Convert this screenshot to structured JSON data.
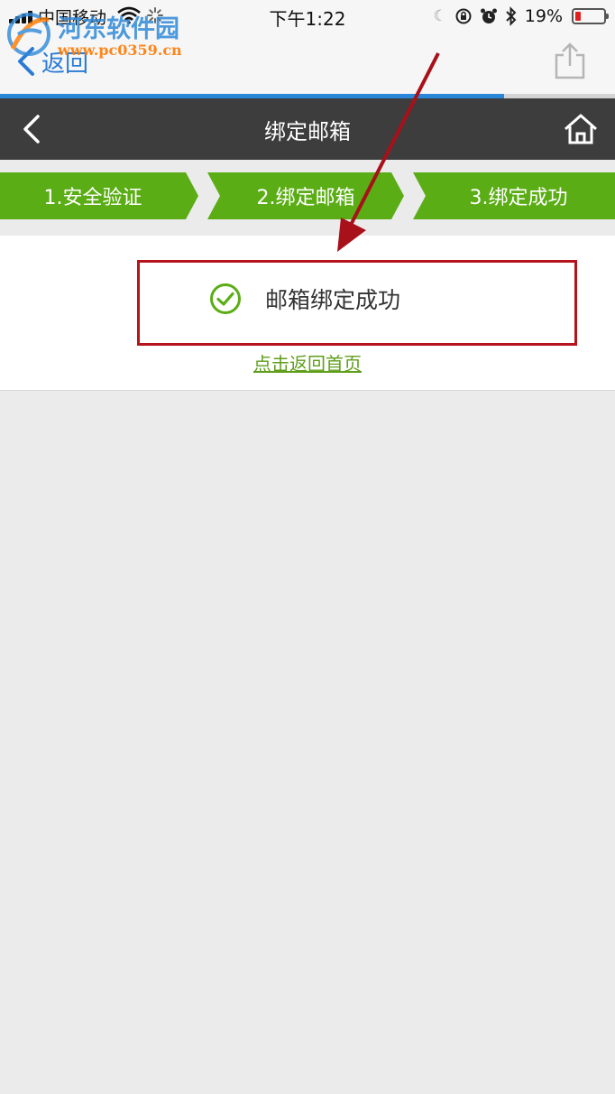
{
  "status_bar": {
    "carrier": "中国移动",
    "time": "下午1:22",
    "battery_percent": "19%",
    "battery_level": 0.19
  },
  "browser": {
    "back_label": "返回",
    "load_progress": 0.82
  },
  "watermark": {
    "name": "河东软件园",
    "url": "www.pc0359.cn"
  },
  "header": {
    "title": "绑定邮箱"
  },
  "steps": [
    {
      "label": "1.安全验证"
    },
    {
      "label": "2.绑定邮箱"
    },
    {
      "label": "3.绑定成功"
    }
  ],
  "result": {
    "message": "邮箱绑定成功",
    "home_link": "点击返回首页"
  },
  "colors": {
    "accent_green": "#5aad15",
    "header_bg": "#3d3d3d",
    "link_blue": "#2a7bd5",
    "annotation_red": "#b5141c"
  },
  "icons": {
    "header_left": "chevron-left-icon",
    "header_right": "home-icon",
    "success": "check-circle-icon",
    "share": "share-icon"
  }
}
